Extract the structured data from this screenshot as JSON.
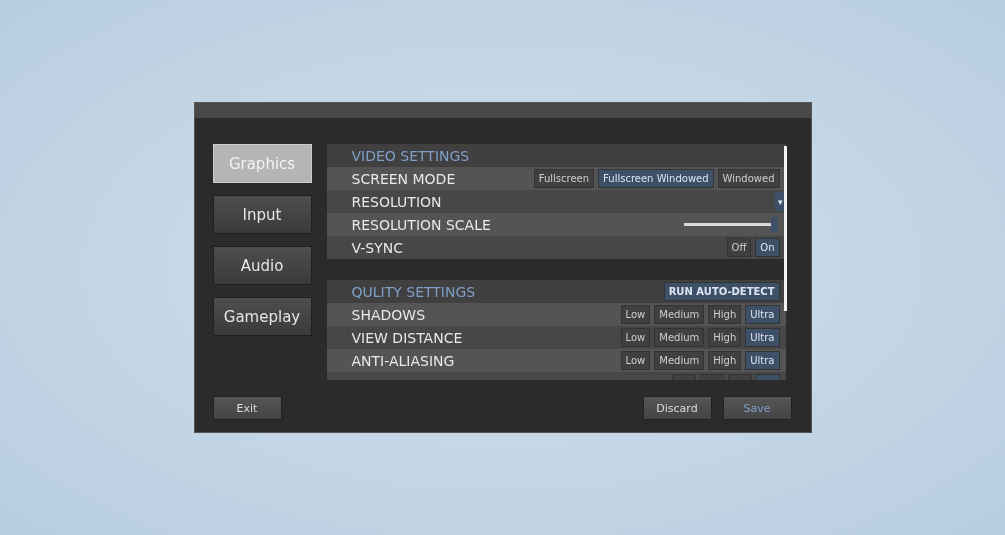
{
  "tabs": [
    {
      "label": "Graphics",
      "selected": true
    },
    {
      "label": "Input",
      "selected": false
    },
    {
      "label": "Audio",
      "selected": false
    },
    {
      "label": "Gameplay",
      "selected": false
    }
  ],
  "sections": [
    {
      "title": "VIDEO SETTINGS",
      "rows": [
        {
          "kind": "options",
          "label": "SCREEN MODE",
          "options": [
            {
              "label": "Fullscreen",
              "selected": false
            },
            {
              "label": "Fullscreen Windowed",
              "selected": true
            },
            {
              "label": "Windowed",
              "selected": false
            }
          ]
        },
        {
          "kind": "dropdown",
          "label": "RESOLUTION",
          "caret": "▾"
        },
        {
          "kind": "slider",
          "label": "RESOLUTION SCALE",
          "level": 0.97
        },
        {
          "kind": "options",
          "label": "V-SYNC",
          "options": [
            {
              "label": "Off",
              "selected": false
            },
            {
              "label": "On",
              "selected": true
            }
          ]
        }
      ]
    },
    {
      "title": "QULITY SETTINGS",
      "action": "RUN AUTO-DETECT",
      "rows": [
        {
          "kind": "options",
          "label": "SHADOWS",
          "options": [
            {
              "label": "Low",
              "selected": false
            },
            {
              "label": "Medium",
              "selected": false
            },
            {
              "label": "High",
              "selected": false
            },
            {
              "label": "Ultra",
              "selected": true
            }
          ]
        },
        {
          "kind": "options",
          "label": "VIEW DISTANCE",
          "options": [
            {
              "label": "Low",
              "selected": false
            },
            {
              "label": "Medium",
              "selected": false
            },
            {
              "label": "High",
              "selected": false
            },
            {
              "label": "Ultra",
              "selected": true
            }
          ]
        },
        {
          "kind": "options",
          "label": "ANTI-ALIASING",
          "options": [
            {
              "label": "Low",
              "selected": false
            },
            {
              "label": "Medium",
              "selected": false
            },
            {
              "label": "High",
              "selected": false
            },
            {
              "label": "Ultra",
              "selected": true
            }
          ]
        },
        {
          "kind": "cut",
          "options": [
            {
              "selected": false
            },
            {
              "selected": false
            },
            {
              "selected": false
            },
            {
              "selected": true
            }
          ]
        }
      ]
    }
  ],
  "buttons": [
    {
      "label": "Exit",
      "highlighted": false
    },
    {
      "label": "Discard",
      "highlighted": false
    },
    {
      "label": "Save",
      "highlighted": true
    }
  ]
}
